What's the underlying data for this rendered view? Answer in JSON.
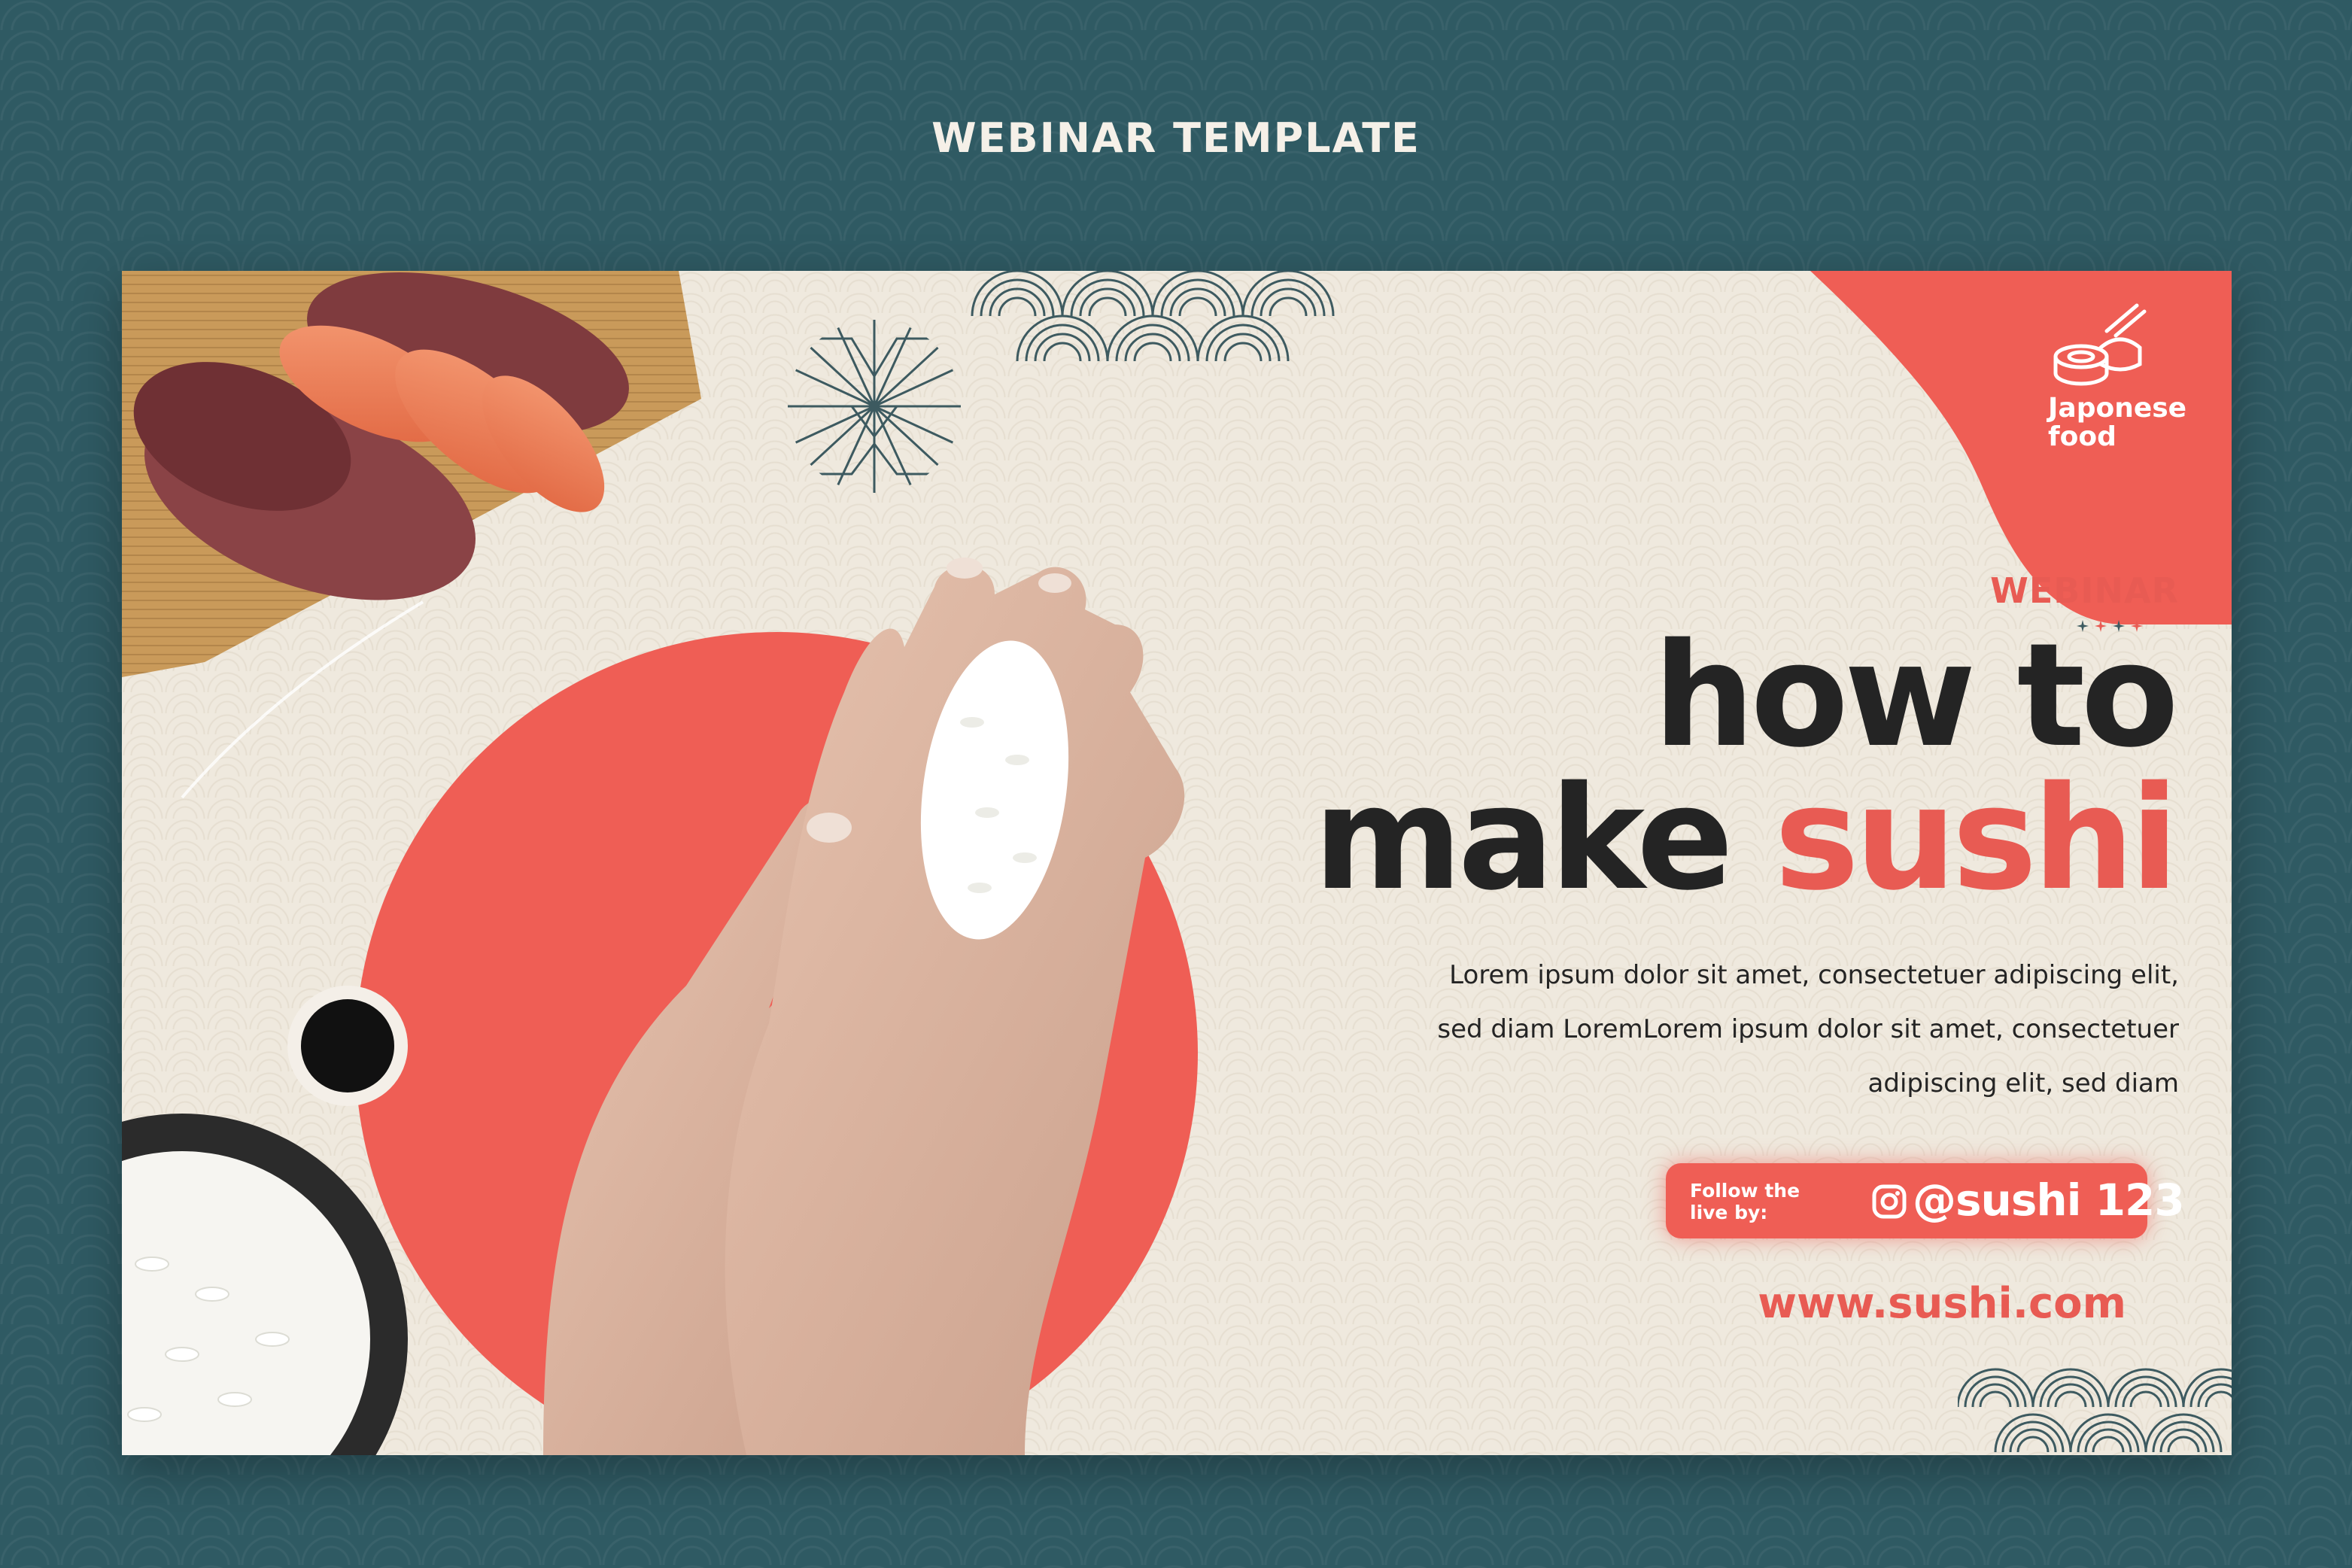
{
  "page": {
    "heading": "WEBINAR TEMPLATE"
  },
  "card": {
    "brand": {
      "logo_line1": "Japonese",
      "logo_line2": "food"
    },
    "eyebrow": "WEBINAR",
    "title": {
      "line1": "how to",
      "line2_main": "make",
      "line2_accent": "sushi"
    },
    "description": {
      "line1": "Lorem ipsum dolor sit amet, consectetuer adipiscing elit,",
      "line2": "sed diam LoremLorem ipsum dolor sit amet, consectetuer",
      "line3": "adipiscing elit, sed diam"
    },
    "follow": {
      "label_line1": "Follow the",
      "label_line2": "live by:",
      "handle": "@sushi 123",
      "icon": "instagram-icon"
    },
    "website": "www.sushi.com"
  },
  "colors": {
    "background": "#2f5a63",
    "card": "#efe9de",
    "accent": "#e85b53",
    "text": "#242424"
  }
}
